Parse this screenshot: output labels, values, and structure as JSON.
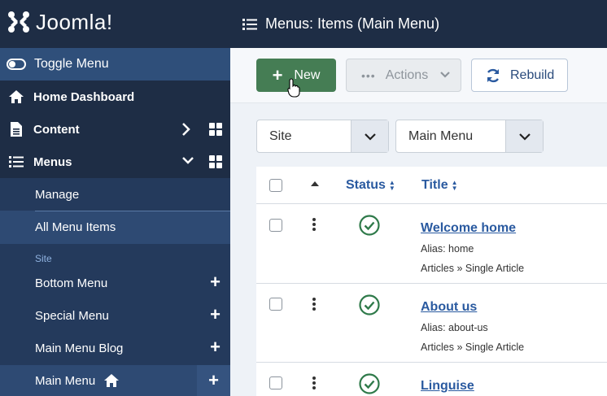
{
  "app": {
    "logo_text": "Joomla!",
    "page_title": "Menus: Items (Main Menu)"
  },
  "sidebar": {
    "toggle_label": "Toggle Menu",
    "items": [
      {
        "label": "Home Dashboard",
        "icon": "home-icon"
      },
      {
        "label": "Content",
        "icon": "file-icon"
      },
      {
        "label": "Menus",
        "icon": "list-icon"
      }
    ],
    "menus_sub": {
      "manage": "Manage",
      "all_items": "All Menu Items",
      "section_label": "Site",
      "menus": [
        "Bottom Menu",
        "Special Menu",
        "Main Menu Blog",
        "Main Menu"
      ]
    }
  },
  "toolbar": {
    "new_label": "New",
    "actions_label": "Actions",
    "rebuild_label": "Rebuild"
  },
  "filters": {
    "client": "Site",
    "menu": "Main Menu"
  },
  "table": {
    "columns": {
      "status": "Status",
      "title": "Title"
    },
    "rows": [
      {
        "title": "Welcome home",
        "alias": "Alias: home",
        "type": "Articles » Single Article"
      },
      {
        "title": "About us",
        "alias": "Alias: about-us",
        "type": "Articles » Single Article"
      },
      {
        "title": "Linguise",
        "alias": "",
        "type": ""
      }
    ]
  },
  "colors": {
    "sidebar_bg": "#1e2d45",
    "sidebar_active": "#2f4f7a",
    "new_button": "#457d54",
    "link": "#2a5aa0",
    "published": "#2f7a4a"
  }
}
